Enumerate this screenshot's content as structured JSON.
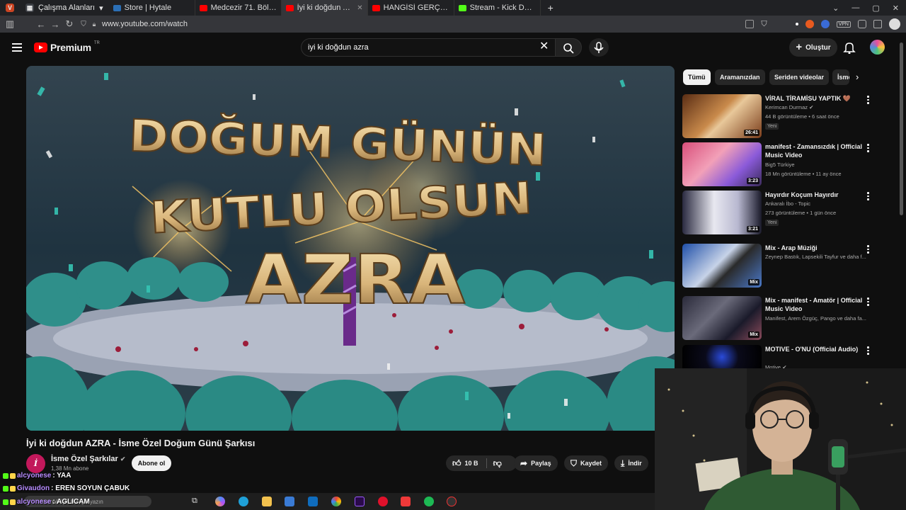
{
  "browser": {
    "workspace_label": "Çalışma Alanları",
    "tabs": [
      {
        "label": "Store | Hytale",
        "color": "#2b6fb5"
      },
      {
        "label": "Medcezir 71. Bölüm (4K) -",
        "color": "#ff0000"
      },
      {
        "label": "İyi ki doğdun AZRA - İsme",
        "color": "#ff0000",
        "active": true
      },
      {
        "label": "HANGİSİ GERÇEK PİLOT!? ft.",
        "color": "#ff0000"
      },
      {
        "label": "Stream - Kick Dashboard",
        "color": "#53fc18"
      }
    ],
    "new_tab": "+",
    "url": "www.youtube.com/watch",
    "vpn": "VPN"
  },
  "youtube": {
    "logo_word": "Premium",
    "logo_region": "TR",
    "search_value": "iyi ki doğdun azra",
    "create_label": "Oluştur"
  },
  "video": {
    "title": "İyi ki doğdun AZRA - İsme Özel Doğum Günü Şarkısı",
    "banner_line1": "DOĞUM GÜNÜN",
    "banner_line2": "KUTLU OLSUN",
    "banner_name": "AZRA",
    "channel": {
      "name": "İsme Özel Şarkılar",
      "subs": "1,38 Mn abone",
      "avatar_letter": "İ"
    },
    "subscribe_label": "Abone ol",
    "likes": "10 B",
    "share_label": "Paylaş",
    "save_label": "Kaydet",
    "download_label": "İndir"
  },
  "chips": [
    "Tümü",
    "Aramanızdan",
    "Seriden videolar",
    "İsme"
  ],
  "recommendations": [
    {
      "title": "VİRAL TİRAMİSU YAPTIK 🤎",
      "channel": "Kerimcan Durmaz",
      "verified": true,
      "meta": "44 B görüntüleme • 6 saat önce",
      "badge": "Yeni",
      "duration": "26:41",
      "thumb": "tiramisu"
    },
    {
      "title": "manifest - Zamansızdık | Official Music Video",
      "channel": "Big5 Türkiye",
      "verified": false,
      "meta": "18 Mn görüntüleme • 11 ay önce",
      "badge": "",
      "duration": "3:23",
      "thumb": "manifest"
    },
    {
      "title": "Hayırdır Koçum Hayırdır",
      "channel": "Ankaralı İbo - Topic",
      "verified": false,
      "meta": "273 görüntüleme • 1 gün önce",
      "badge": "Yeni",
      "duration": "3:21",
      "thumb": "ibo"
    },
    {
      "title": "Mix - Arap Müziği",
      "channel": "Zeynep Bastık, Lapsekili Tayfur ve daha f...",
      "verified": false,
      "meta": "",
      "badge": "",
      "duration": "Mix",
      "thumb": "mix1"
    },
    {
      "title": "Mix - manifest - Amatör | Official Music Video",
      "channel": "Manifest, Arem Özgüç, Pango ve daha fa...",
      "verified": false,
      "meta": "",
      "badge": "",
      "duration": "Mix",
      "thumb": "mix2"
    },
    {
      "title": "MOTIVE - O'NU (Official Audio)",
      "channel": "Motive",
      "verified": true,
      "meta": "",
      "badge": "",
      "duration": "",
      "thumb": "motive"
    }
  ],
  "chat": [
    {
      "user": "alcyonese",
      "msg": ": YAA"
    },
    {
      "user": "Givaudon",
      "msg": ": EREN SOYUN ÇABUK"
    },
    {
      "user": "alcyonese",
      "msg": ": AGLICAM"
    }
  ],
  "taskbar": {
    "search_placeholder": "Aramak için buraya yazın"
  },
  "colors": {
    "bg": "#0f0f0f",
    "accent": "#ff0000",
    "chat_user": "#b78cff"
  }
}
